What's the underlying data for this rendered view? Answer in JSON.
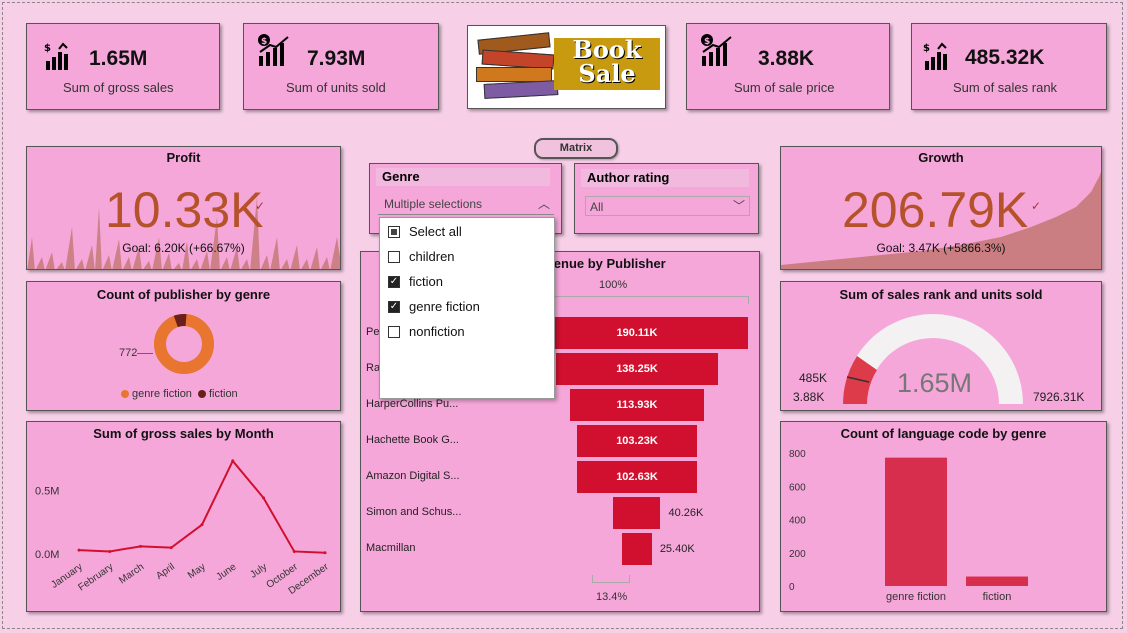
{
  "kpis": [
    {
      "value": "1.65M",
      "label": "Sum of gross sales"
    },
    {
      "value": "7.93M",
      "label": "Sum of units sold"
    },
    {
      "value": "3.88K",
      "label": "Sum of sale price"
    },
    {
      "value": "485.32K",
      "label": "Sum of sales rank"
    }
  ],
  "logo": {
    "line1": "Book",
    "line2": "Sale"
  },
  "matrix_button": "Matrix",
  "profit": {
    "title": "Profit",
    "value": "10.33K",
    "goal": "Goal: 6.20K (+66.67%)"
  },
  "growth": {
    "title": "Growth",
    "value": "206.79K",
    "goal": "Goal: 3.47K (+5866.3%)"
  },
  "genre_slicer": {
    "title": "Genre",
    "value": "Multiple selections",
    "items": [
      {
        "label": "Select all",
        "state": "partial"
      },
      {
        "label": "children",
        "state": "unchecked"
      },
      {
        "label": "fiction",
        "state": "checked"
      },
      {
        "label": "genre fiction",
        "state": "checked"
      },
      {
        "label": "nonfiction",
        "state": "unchecked"
      }
    ]
  },
  "author_slicer": {
    "title": "Author rating",
    "value": "All"
  },
  "donut": {
    "title": "Count of publisher by genre",
    "label_value": "772",
    "legend": [
      "genre fiction",
      "fiction"
    ]
  },
  "funnel": {
    "title": "revenue by Publisher",
    "top_pct": "100%",
    "bottom_pct": "13.4%"
  },
  "gauge": {
    "title": "Sum of sales rank and units sold",
    "center": "1.65M",
    "target": "485K",
    "min": "3.88K",
    "max": "7926.31K"
  },
  "line_chart_title": "Sum of gross sales by Month",
  "bar_chart_title": "Count of language code by genre",
  "colors": {
    "card": "#f6a7da",
    "accent": "#d0102e",
    "kpi_value": "#b5522a"
  },
  "chart_data": [
    {
      "type": "bar",
      "title": "revenue by Publisher",
      "categories": [
        "Penguin Group (USA) LLC",
        "Random House LLC",
        "HarperCollins Publishers",
        "Hachette Book Group",
        "Amazon Digital Services,  Inc.",
        "Simon and Schuster Digital Sales Inc",
        "Macmillan"
      ],
      "category_labels": [
        "Pe",
        "Ra",
        "HarperCollins Pu...",
        "Hachette Book G...",
        "Amazon Digital S...",
        "Simon and Schus...",
        "Macmillan"
      ],
      "values": [
        190.11,
        138.25,
        113.93,
        103.23,
        102.63,
        40.26,
        25.4
      ],
      "value_labels": [
        "190.11K",
        "138.25K",
        "113.93K",
        "103.23K",
        "102.63K",
        "40.26K",
        "25.40K"
      ]
    },
    {
      "type": "line",
      "title": "Sum of gross sales by Month",
      "x": [
        "January",
        "February",
        "March",
        "April",
        "May",
        "June",
        "July",
        "October",
        "December"
      ],
      "y": [
        0.03,
        0.02,
        0.06,
        0.05,
        0.23,
        0.73,
        0.44,
        0.02,
        0.01
      ],
      "ylabel": "",
      "yticks": [
        "0.0M",
        "0.5M"
      ],
      "ylim": [
        0,
        0.8
      ]
    },
    {
      "type": "bar",
      "title": "Count of language code by genre",
      "categories": [
        "genre fiction",
        "fiction"
      ],
      "values": [
        772,
        57
      ],
      "yticks": [
        "0",
        "200",
        "400",
        "600",
        "800"
      ],
      "ylim": [
        0,
        800
      ]
    },
    {
      "type": "pie",
      "title": "Count of publisher by genre",
      "categories": [
        "genre fiction",
        "fiction"
      ],
      "values": [
        772,
        57
      ]
    }
  ]
}
